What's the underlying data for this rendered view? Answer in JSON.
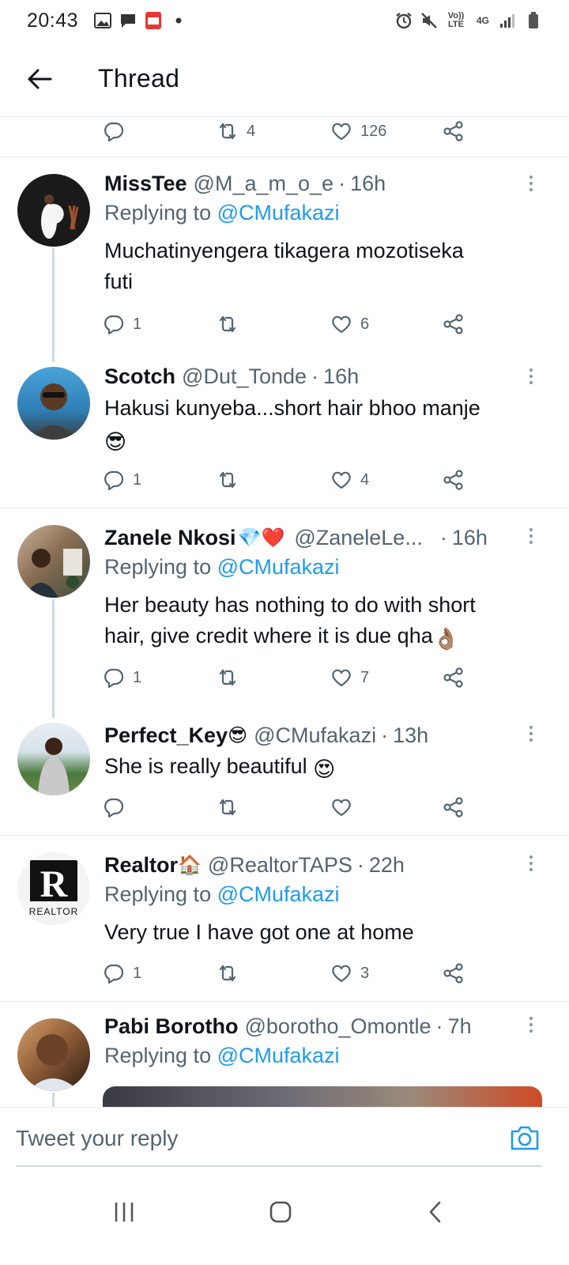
{
  "status_bar": {
    "time": "20:43",
    "left_icons": [
      "image-icon",
      "chat-icon",
      "pdf-icon",
      "dot-icon"
    ],
    "right_icons": [
      "alarm-icon",
      "mute-icon",
      "volte-icon",
      "4g-icon",
      "signal-icon",
      "battery-icon"
    ],
    "volte_text": "Vo))\nLTE",
    "network_text": "4G"
  },
  "header": {
    "title": "Thread"
  },
  "top_actions": {
    "retweets": "4",
    "likes": "126"
  },
  "tweets": [
    {
      "name": "MissTee",
      "handle": "@M_a_m_o_e",
      "time": "16h",
      "replying_label": "Replying to",
      "replying_to": "@CMufakazi",
      "text_lines": [
        "Muchatinyengera tikagera mozotiseka",
        "futi"
      ],
      "replies": "1",
      "retweets": "",
      "likes": "6"
    },
    {
      "name": "Scotch",
      "handle": "@Dut_Tonde",
      "time": "16h",
      "text_lines": [
        "Hakusi kunyeba...short hair bhoo manje"
      ],
      "emoji": "😎",
      "replies": "1",
      "retweets": "",
      "likes": "4"
    },
    {
      "name": "Zanele Nkosi",
      "name_emoji": "💎❤️",
      "handle": "@ZaneleLe...",
      "time": "16h",
      "replying_label": "Replying to",
      "replying_to": "@CMufakazi",
      "text_lines": [
        "Her beauty has nothing to do with short",
        "hair, give credit where it is due qha"
      ],
      "emoji": "👌🏽",
      "replies": "1",
      "retweets": "",
      "likes": "7"
    },
    {
      "name": "Perfect_Key",
      "name_emoji": "😎",
      "handle": "@CMufakazi",
      "time": "13h",
      "text_lines": [
        "She is really beautiful"
      ],
      "emoji": "😍",
      "replies": "",
      "retweets": "",
      "likes": ""
    },
    {
      "name": "Realtor",
      "name_emoji": "🏠",
      "handle": "@RealtorTAPS",
      "time": "22h",
      "replying_label": "Replying to",
      "replying_to": "@CMufakazi",
      "text_lines": [
        "Very true I have got one at home"
      ],
      "avatar_text": "REALTOR",
      "replies": "1",
      "retweets": "",
      "likes": "3"
    },
    {
      "name": "Pabi Borotho",
      "handle": "@borotho_Omontle",
      "time": "7h",
      "replying_label": "Replying to",
      "replying_to": "@CMufakazi"
    }
  ],
  "composer": {
    "placeholder": "Tweet your reply"
  },
  "colors": {
    "accent": "#1d9bf0",
    "muted": "#536471",
    "text": "#0f1419",
    "divider": "#e6ecf0"
  }
}
